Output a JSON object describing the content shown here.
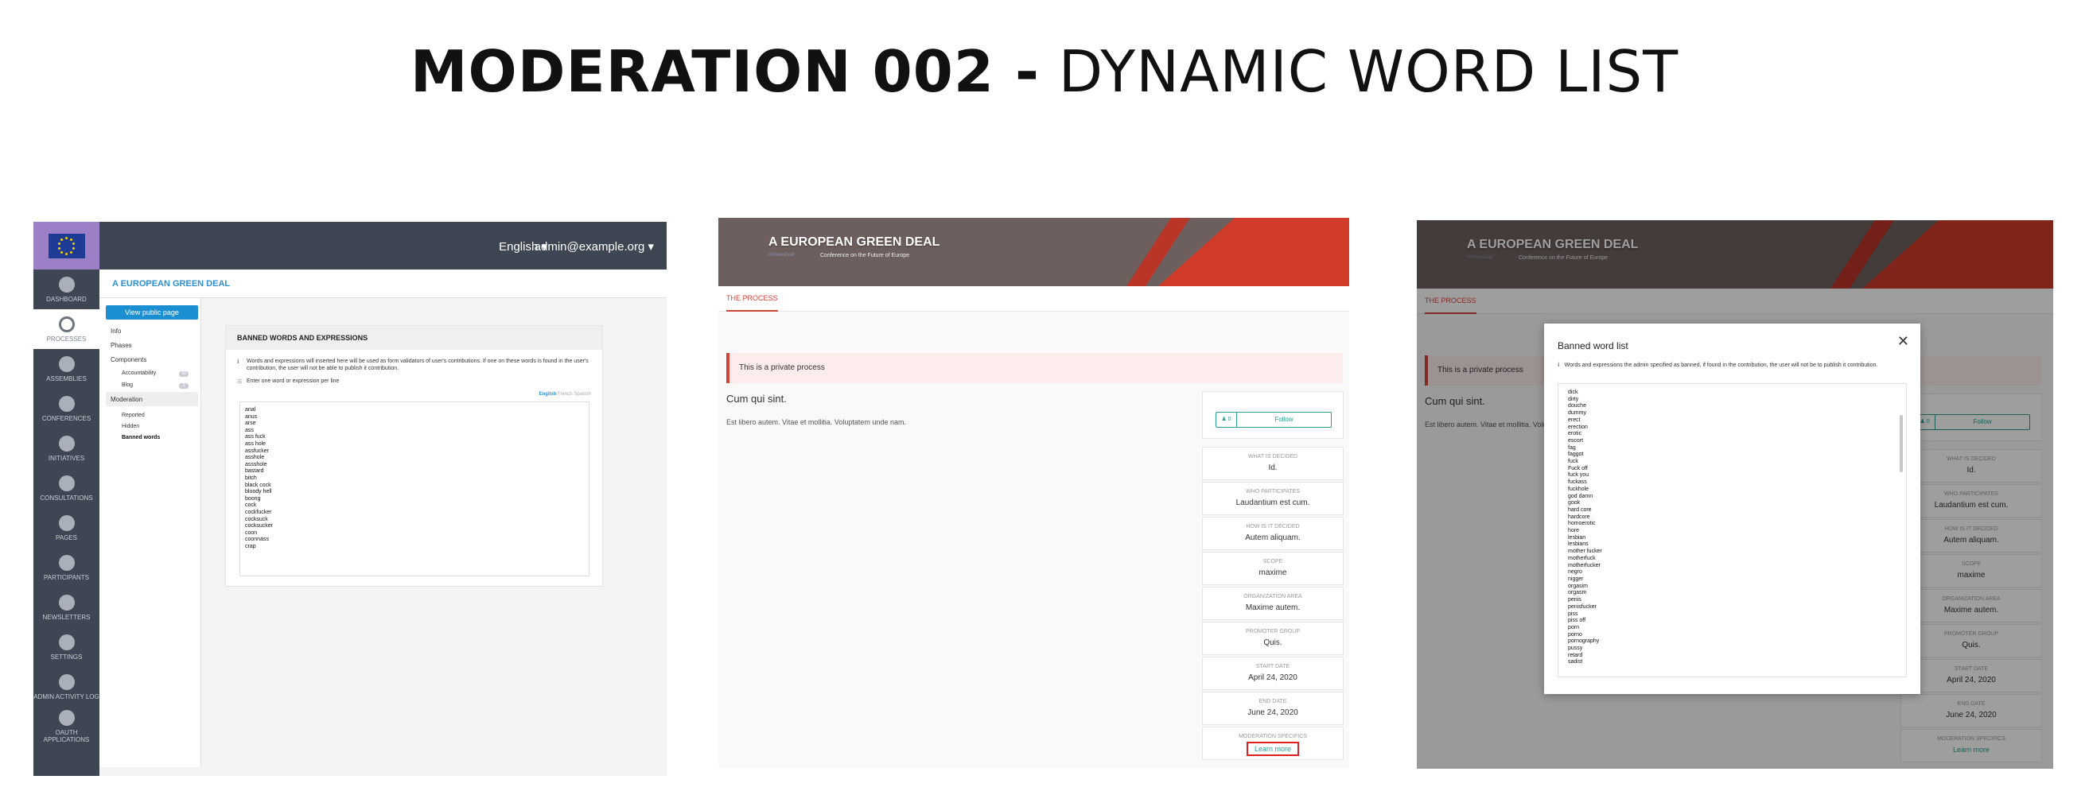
{
  "title": {
    "bold": "MODERATION 002 -",
    "normal": " DYNAMIC WORD LIST"
  },
  "admin": {
    "lang": "English ▾",
    "user": "admin@example.org ▾",
    "breadcrumb": "A EUROPEAN GREEN DEAL",
    "nav": [
      "DASHBOARD",
      "PROCESSES",
      "ASSEMBLIES",
      "CONFERENCES",
      "INITIATIVES",
      "CONSULTATIONS",
      "PAGES",
      "PARTICIPANTS",
      "NEWSLETTERS",
      "SETTINGS",
      "ADMIN ACTIVITY LOG",
      "OAUTH APPLICATIONS"
    ],
    "view_public": "View public page",
    "subnav": {
      "info": "Info",
      "phases": "Phases",
      "components": "Components",
      "accountability": "Accountability",
      "accountability_badge": "16",
      "blog": "Blog",
      "blog_badge": "3",
      "moderation": "Moderation",
      "reported": "Reported",
      "hidden": "Hidden",
      "banned": "Banned words"
    },
    "card": {
      "heading": "BANNED WORDS AND EXPRESSIONS",
      "help": "Words and expressions will inserted here will be used as form validators of user's contributions. If one on these words is found in the user's contribution, the user will not be able to publish it contribution.",
      "hint": "Enter one word or expression per line",
      "lang_active": "English",
      "lang_rest": " French Spanish",
      "words": "anal\nanus\narse\nass\nass fuck\nass hole\nassfucker\nasshole\nassshole\nbastard\nbitch\nblack cock\nbloody hell\nboong\ncock\ncockfucker\ncocksuck\ncocksucker\ncoon\ncoonnass\ncrap"
    }
  },
  "public": {
    "hero_title": "A EUROPEAN GREEN DEAL",
    "hashtag": "#GreenDeal",
    "hero_sub": "Conference on the Future of Europe",
    "tab": "THE PROCESS",
    "private": "This is a private process",
    "proc_title": "Cum qui sint.",
    "proc_desc": "Est libero autem. Vitae et mollitia. Voluptatem unde nam.",
    "follow_count": "♟ 0",
    "follow": "Follow",
    "meta": [
      {
        "k": "WHAT IS DECIDED",
        "v": "Id."
      },
      {
        "k": "WHO PARTICIPATES",
        "v": "Laudantium est cum."
      },
      {
        "k": "HOW IS IT DECIDED",
        "v": "Autem aliquam."
      },
      {
        "k": "SCOPE",
        "v": "maxime"
      },
      {
        "k": "ORGANIZATION AREA",
        "v": "Maxime autem."
      },
      {
        "k": "PROMOTER GROUP",
        "v": "Quis."
      },
      {
        "k": "START DATE",
        "v": "April 24, 2020"
      },
      {
        "k": "END DATE",
        "v": "June 24, 2020"
      }
    ],
    "mod_label": "MODERATION SPECIFICS",
    "learn_more": "Learn more"
  },
  "modal": {
    "title": "Banned word list",
    "close": "✕",
    "info_icon": "ℹ",
    "info": "Words and expressions the admin specified as banned, if found in the contribution, the user will not be to publish it contribution.",
    "words": "dick\ndirty\ndouche\ndummy\nerect\nerection\nerotic\nescort\nfag\nfaggot\nfuck\nFuck off\nfuck you\nfuckass\nfuckhole\ngod damn\ngook\nhard core\nhardcore\nhomoerotic\nhore\nlesbian\nlesbians\nmother fucker\nmotherfuck\nmotherfucker\nnegro\nnigger\norgasim\norgasm\npenis\npenisfucker\npiss\npiss off\nporn\nporno\npornography\npussy\nretard\nsadist"
  },
  "colors": {
    "sidebar": "#3e4653",
    "accent_red": "#d0443a",
    "teal": "#2a9d8f",
    "link_blue": "#2d8fd0"
  }
}
